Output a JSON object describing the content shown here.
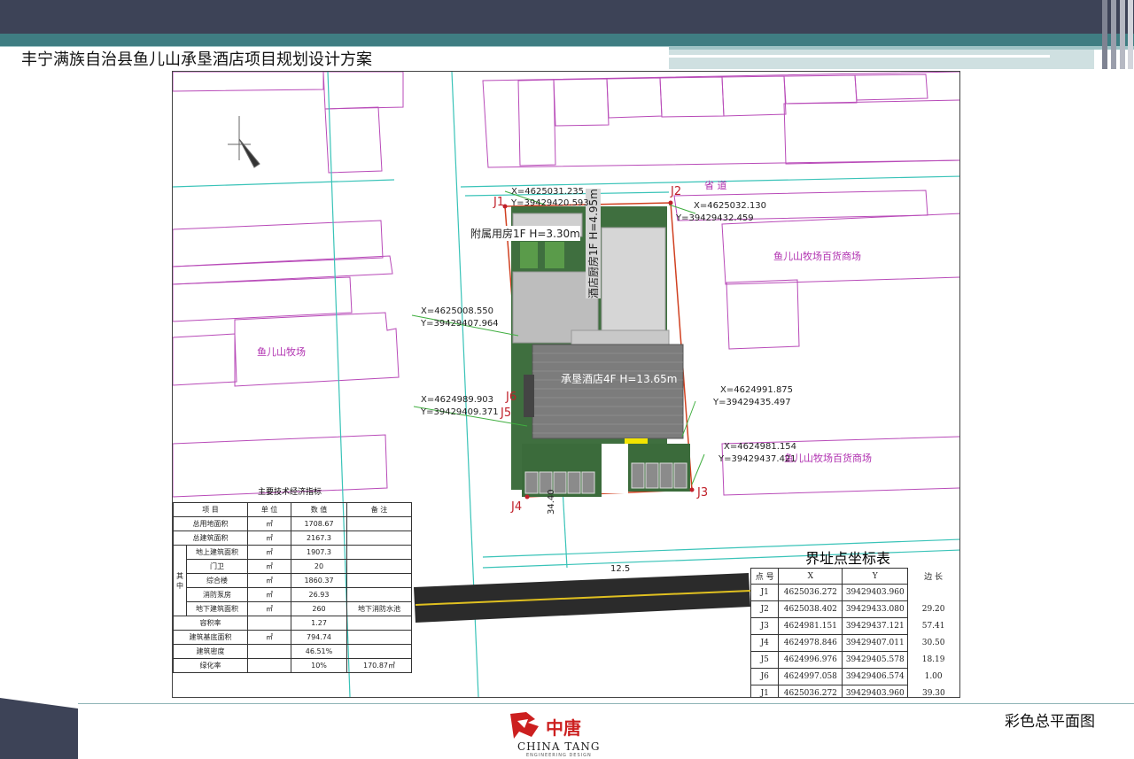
{
  "header": {
    "title": "丰宁满族自治县鱼儿山承垦酒店项目规划设计方案"
  },
  "footer": {
    "caption": "彩色总平面图",
    "logo_cn": "中唐",
    "logo_en": "CHINA TANG",
    "logo_sub": "ENGINEERING DESIGN"
  },
  "plan": {
    "labels": {
      "road": "省 道",
      "annex": "附属用房1F H=3.30m",
      "kitchen": "酒店厨房1F H=4.95m",
      "hotel": "承垦酒店4F H=13.65m",
      "market1": "鱼儿山牧场百货商场",
      "market2": "鱼儿山牧场百货商场",
      "ranch": "鱼儿山牧场",
      "dist1": "34.40",
      "dist2": "12.5",
      "p_j1": "J1",
      "p_j2": "J2",
      "p_j3": "J3",
      "p_j4": "J4",
      "p_j5": "J5",
      "p_j6": "J6",
      "c1x": "X=4625031.235",
      "c1y": "Y=39429420.593",
      "c2x": "X=4625032.130",
      "c2y": "Y=39429432.459",
      "c3x": "X=4625008.550",
      "c3y": "Y=39429407.964",
      "c4x": "X=4624989.903",
      "c4y": "Y=39429409.371",
      "c5x": "X=4624991.875",
      "c5y": "Y=39429435.497",
      "c6x": "X=4624981.154",
      "c6y": "Y=39429437.421"
    }
  },
  "tech_table": {
    "title": "主要技术经济指标",
    "headers": [
      "项  目",
      "单  位",
      "数  值",
      "备  注"
    ],
    "group_label": "其中",
    "rows": [
      {
        "item": "总用地面积",
        "unit": "㎡",
        "value": "1708.67",
        "note": ""
      },
      {
        "item": "总建筑面积",
        "unit": "㎡",
        "value": "2167.3",
        "note": ""
      },
      {
        "item": "地上建筑面积",
        "unit": "㎡",
        "value": "1907.3",
        "note": ""
      },
      {
        "item": "门卫",
        "unit": "㎡",
        "value": "20",
        "note": ""
      },
      {
        "item": "综合楼",
        "unit": "㎡",
        "value": "1860.37",
        "note": ""
      },
      {
        "item": "消防泵房",
        "unit": "㎡",
        "value": "26.93",
        "note": ""
      },
      {
        "item": "地下建筑面积",
        "unit": "㎡",
        "value": "260",
        "note": "地下消防水池"
      },
      {
        "item": "容积率",
        "unit": "",
        "value": "1.27",
        "note": ""
      },
      {
        "item": "建筑基底面积",
        "unit": "㎡",
        "value": "794.74",
        "note": ""
      },
      {
        "item": "建筑密度",
        "unit": "",
        "value": "46.51%",
        "note": ""
      },
      {
        "item": "绿化率",
        "unit": "",
        "value": "10%",
        "note": "170.87㎡"
      }
    ]
  },
  "coord_table": {
    "title": "界址点坐标表",
    "headers": [
      "点 号",
      "X",
      "Y",
      "边 长"
    ],
    "rows": [
      {
        "point": "J1",
        "x": "4625036.272",
        "y": "39429403.960"
      },
      {
        "point": "J2",
        "x": "4625038.402",
        "y": "39429433.080"
      },
      {
        "point": "J3",
        "x": "4624981.151",
        "y": "39429437.121"
      },
      {
        "point": "J4",
        "x": "4624978.846",
        "y": "39429407.011"
      },
      {
        "point": "J5",
        "x": "4624996.976",
        "y": "39429405.578"
      },
      {
        "point": "J6",
        "x": "4624997.058",
        "y": "39429406.574"
      },
      {
        "point": "J1",
        "x": "4625036.272",
        "y": "39429403.960"
      }
    ],
    "lengths": [
      "29.20",
      "57.41",
      "30.50",
      "18.19",
      "1.00",
      "39.30"
    ]
  }
}
